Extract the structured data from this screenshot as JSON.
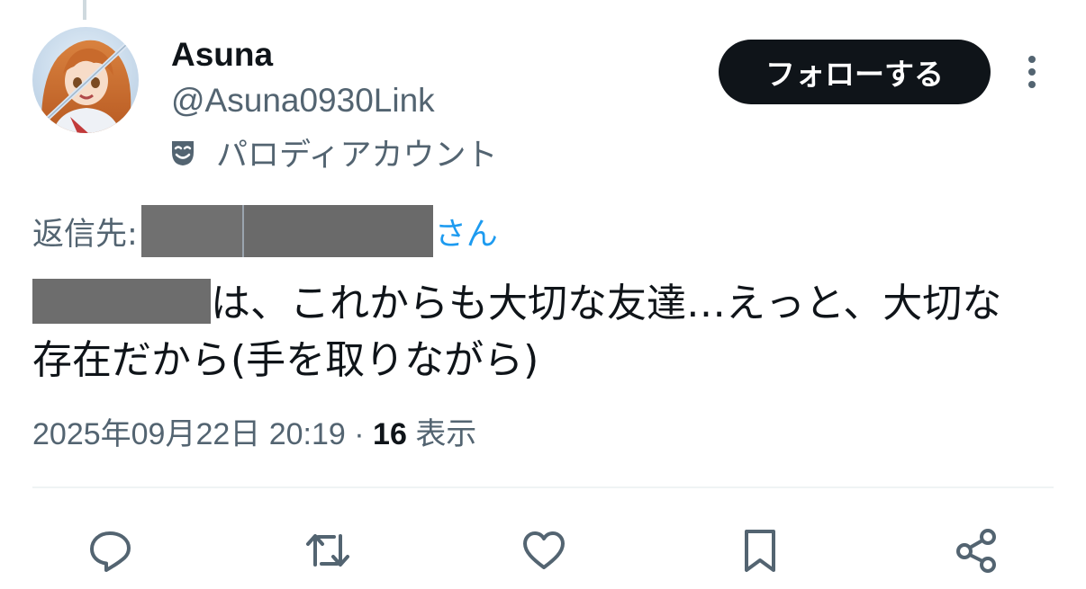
{
  "author": {
    "display_name": "Asuna",
    "handle": "@Asuna0930Link",
    "account_label": "パロディアカウント",
    "account_label_icon": "theater-mask-icon"
  },
  "follow_button_label": "フォローする",
  "reply": {
    "prefix": "返信先:",
    "suffix": "さん"
  },
  "tweet": {
    "text_after_redaction": "は、これからも大切な友達…えっと、大切な存在だから(手を取りながら)"
  },
  "meta": {
    "timestamp": "2025年09月22日 20:19",
    "separator": " · ",
    "views_count": "16",
    "views_label": "表示"
  },
  "actions": [
    "reply-icon",
    "repost-icon",
    "like-icon",
    "bookmark-icon",
    "share-icon"
  ],
  "colors": {
    "text": "#0f1419",
    "secondary": "#536471",
    "link": "#1d9bf0",
    "follow_bg": "#0f1419",
    "divider": "#eff3f4"
  }
}
